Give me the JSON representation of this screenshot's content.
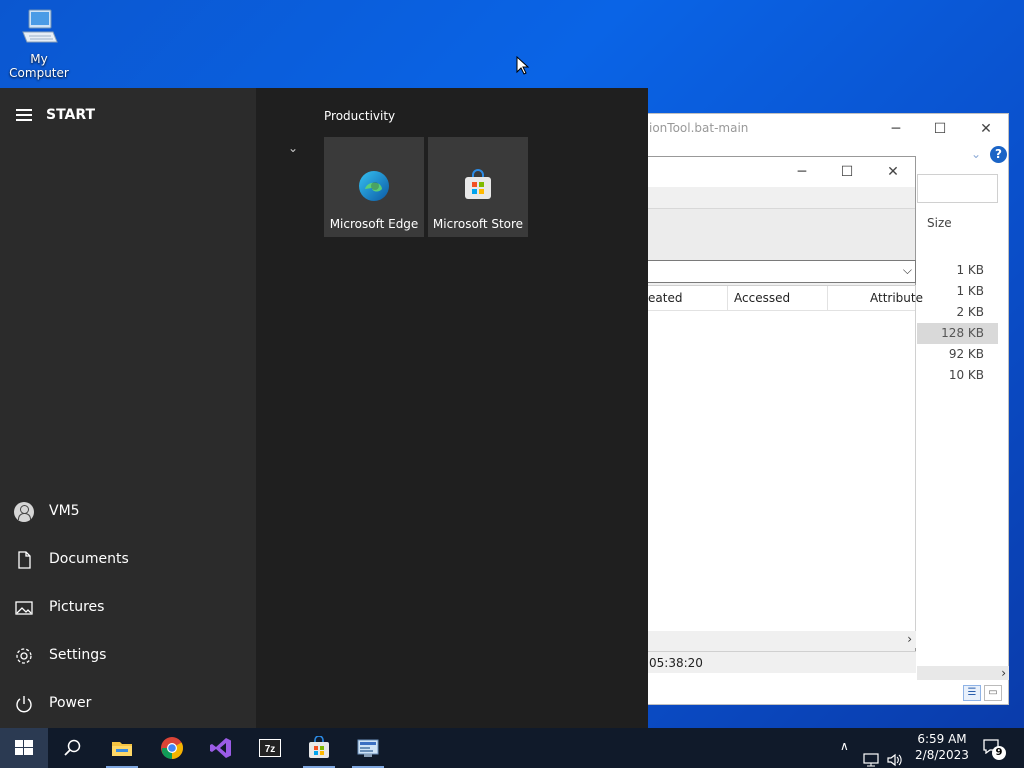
{
  "desktop": {
    "icons": [
      {
        "label": "My Computer",
        "icon": "computer-icon"
      }
    ]
  },
  "explorer_window": {
    "title": "ionTool.bat-main",
    "size_header": "Size",
    "sizes": [
      "1 KB",
      "1 KB",
      "2 KB",
      "128 KB",
      "92 KB",
      "10 KB"
    ],
    "selected_row": 3
  },
  "dialog_window": {
    "columns": [
      "eated",
      "Accessed",
      "Attribute"
    ],
    "status_text": "05:38:20"
  },
  "start_menu": {
    "header": "START",
    "group_title": "Productivity",
    "tiles": [
      {
        "label": "Microsoft Edge",
        "icon": "edge-icon"
      },
      {
        "label": "Microsoft Store",
        "icon": "store-icon"
      }
    ],
    "user": "VM5",
    "items": [
      {
        "label": "Documents",
        "icon": "document-icon"
      },
      {
        "label": "Pictures",
        "icon": "pictures-icon"
      },
      {
        "label": "Settings",
        "icon": "gear-icon"
      },
      {
        "label": "Power",
        "icon": "power-icon"
      }
    ]
  },
  "taskbar": {
    "pinned": [
      "windows-start-icon",
      "search-icon",
      "file-explorer-icon",
      "chrome-icon",
      "visual-studio-icon",
      "7zip-icon",
      "microsoft-store-icon",
      "network-app-icon"
    ],
    "clock_time": "6:59 AM",
    "clock_date": "2/8/2023",
    "notification_count": "9"
  },
  "colors": {
    "desktop": "#0a64e6",
    "start_left": "#2b2b2b",
    "start_right": "#1f1f1f",
    "tile": "#3a3a3a",
    "taskbar": "#101a2a"
  }
}
